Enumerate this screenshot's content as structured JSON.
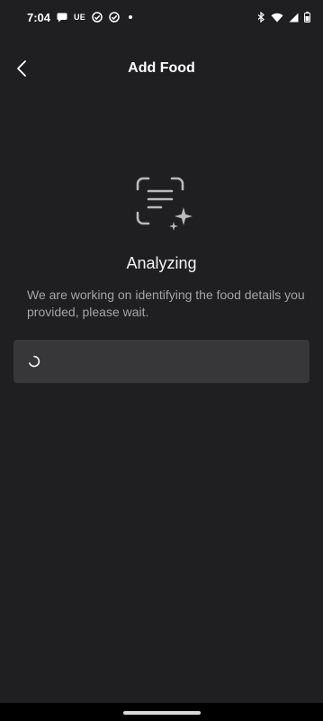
{
  "status_bar": {
    "time": "7:04",
    "carrier_badge": "UE",
    "icons": [
      "chat-bubble-icon",
      "check-circle-icon",
      "check-circle-icon",
      "dot-icon",
      "bluetooth-icon",
      "wifi-icon",
      "cell-signal-icon",
      "battery-icon"
    ]
  },
  "header": {
    "title": "Add Food",
    "back_icon": "chevron-left-icon"
  },
  "analyzing": {
    "icon": "scan-text-sparkle-icon",
    "title": "Analyzing",
    "message": "We are working on identifying the food details you provided, please wait."
  },
  "loading_card": {
    "icon": "spinner-icon"
  },
  "colors": {
    "background": "#1f1f21",
    "card": "#37373a",
    "text_primary": "#ffffff",
    "text_secondary": "#a4a4a8"
  }
}
